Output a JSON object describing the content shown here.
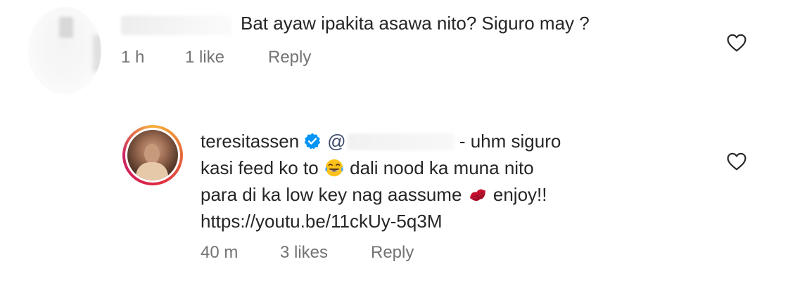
{
  "comment": {
    "text": "Bat ayaw ipakita asawa nito? Siguro may ?",
    "time": "1 h",
    "likes": "1 like",
    "reply_label": "Reply"
  },
  "reply": {
    "username": "teresitassen",
    "mention_prefix": "@",
    "line1_rest": " - uhm siguro",
    "line2_a": "kasi feed ko to ",
    "line2_b": " dali nood ka muna nito",
    "line3_a": "para di ka low key nag aassume ",
    "line3_b": "  enjoy!!",
    "line4": "https://youtu.be/11ckUy-5q3M",
    "time": "40 m",
    "likes": "3 likes",
    "reply_label": "Reply"
  },
  "icons": {
    "heart": "heart-outline-icon",
    "verified": "verified-badge-icon",
    "laugh_emoji": "tears-of-joy-emoji",
    "kiss_emoji": "kiss-mark-emoji"
  },
  "colors": {
    "text": "#262626",
    "meta": "#737373",
    "verified": "#0095f6",
    "kiss": "#c8102e"
  }
}
